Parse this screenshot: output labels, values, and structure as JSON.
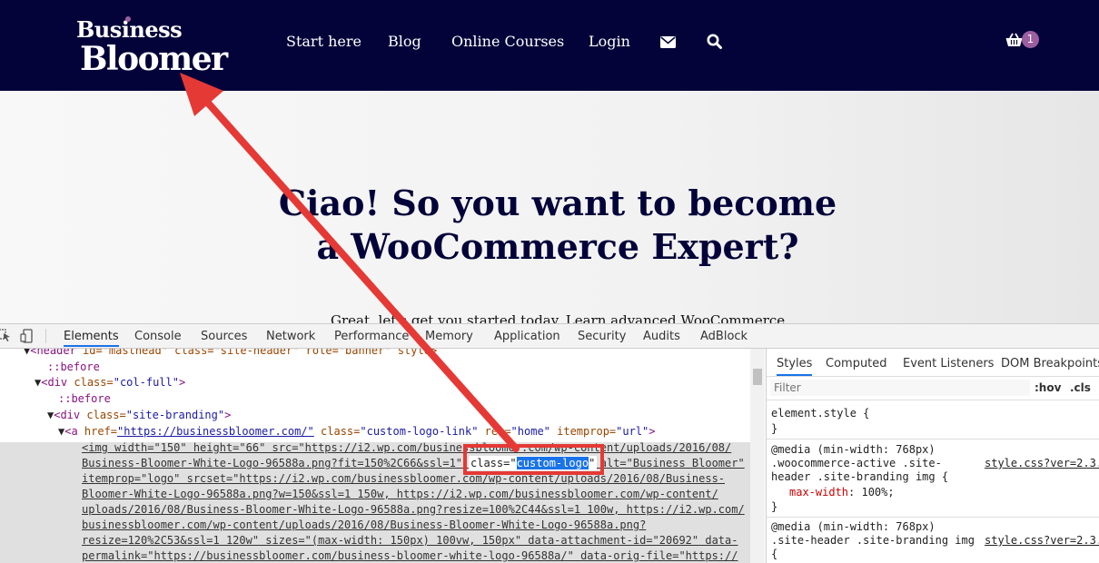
{
  "site": {
    "logo_line1": "Business",
    "logo_line2": "Bloomer",
    "nav": [
      "Start here",
      "Blog",
      "Online Courses",
      "Login"
    ],
    "cart_count": "1",
    "icons": [
      "envelope-icon",
      "search-icon",
      "basket-icon"
    ]
  },
  "hero": {
    "title_line1": "Ciao! So you want to become",
    "title_line2": "a WooCommerce Expert?",
    "subtitle": "Great, let's get you started today. Learn advanced WooCommerce"
  },
  "devtools": {
    "tabs": [
      "Elements",
      "Console",
      "Sources",
      "Network",
      "Performance",
      "Memory",
      "Application",
      "Security",
      "Audits",
      "AdBlock"
    ],
    "active_tab": "Elements",
    "dom": {
      "l0_tag_open": "<header",
      "l0_attrs": " id=\"masthead\" class=\"site-header\" role=\"banner\" style>",
      "l1": "::before",
      "l2_tag": "<div",
      "l2_attr": " class=",
      "l2_val": "\"col-full\"",
      "l2_close": ">",
      "l3": "::before",
      "l4_tag": "<div",
      "l4_attr": " class=",
      "l4_val": "\"site-branding\"",
      "l4_close": ">",
      "l5_tag": "<a",
      "l5_attr1": " href=",
      "l5_val1": "\"https://businessbloomer.com/\"",
      "l5_attr2": " class=",
      "l5_val2": "\"custom-logo-link\"",
      "l5_attr3": " rel=",
      "l5_val3": "\"home\"",
      "l5_attr4": " itemprop=",
      "l5_val4": "\"url\"",
      "l5_close": ">",
      "img_lines": [
        "<img width=\"150\" height=\"66\" src=\"https://i2.wp.com/businessbloomer.com/wp-content/uploads/2016/08/",
        "Business-Bloomer-White-Logo-96588a.png?fit=150%2C66&ssl=1\" class=\"custom-logo\" alt=\"Business Bloomer\"",
        "itemprop=\"logo\" srcset=\"https://i2.wp.com/businessbloomer.com/wp-content/uploads/2016/08/Business-",
        "Bloomer-White-Logo-96588a.png?w=150&ssl=1 150w, https://i2.wp.com/businessbloomer.com/wp-content/",
        "uploads/2016/08/Business-Bloomer-White-Logo-96588a.png?resize=100%2C44&ssl=1 100w, https://i2.wp.com/",
        "businessbloomer.com/wp-content/uploads/2016/08/Business-Bloomer-White-Logo-96588a.png?",
        "resize=120%2C53&ssl=1 120w\" sizes=\"(max-width: 150px) 100vw, 150px\" data-attachment-id=\"20692\" data-",
        "permalink=\"https://businessbloomer.com/business-bloomer-white-logo-96588a/\" data-orig-file=\"https://"
      ],
      "highlight_attr": "class=\"",
      "highlight_val": "custom-logo",
      "highlight_end": "\""
    },
    "styles_tabs": [
      "Styles",
      "Computed",
      "Event Listeners",
      "DOM Breakpoints"
    ],
    "filter_placeholder": "Filter",
    "hov": ":hov",
    "cls": ".cls",
    "rules": {
      "r0_selector": "element.style {",
      "r0_close": "}",
      "r1_media": "@media (min-width: 768px)",
      "r1_sel1": ".woocommerce-active .site-",
      "r1_sel2": "header .site-branding img {",
      "r1_src": "style.css?ver=2.3.",
      "r1_prop": "max-width",
      "r1_value": ": 100%;",
      "r1_close": "}",
      "r2_media": "@media (min-width: 768px)",
      "r2_sel": ".site-header .site-branding img",
      "r2_src": "style.css?ver=2.3.",
      "r2_open": "{"
    }
  },
  "colors": {
    "header_bg": "#03033a",
    "accent_purple": "#9b5ea0",
    "annotation_red": "#e53935",
    "selection_blue": "#1a73e8"
  }
}
